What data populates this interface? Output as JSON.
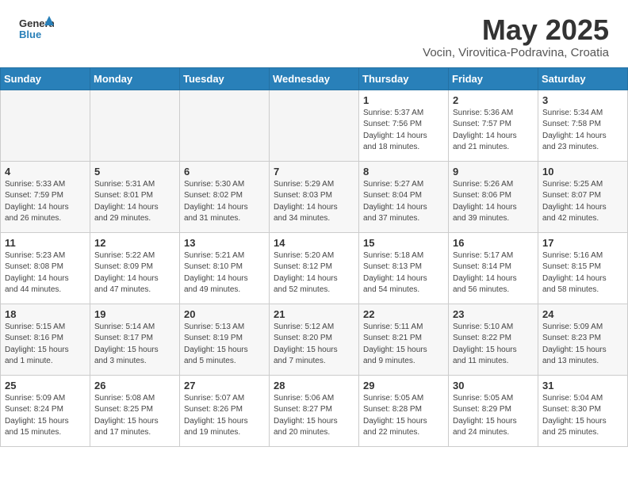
{
  "header": {
    "logo_general": "General",
    "logo_blue": "Blue",
    "month_year": "May 2025",
    "location": "Vocin, Virovitica-Podravina, Croatia"
  },
  "weekdays": [
    "Sunday",
    "Monday",
    "Tuesday",
    "Wednesday",
    "Thursday",
    "Friday",
    "Saturday"
  ],
  "weeks": [
    [
      {
        "day": "",
        "info": ""
      },
      {
        "day": "",
        "info": ""
      },
      {
        "day": "",
        "info": ""
      },
      {
        "day": "",
        "info": ""
      },
      {
        "day": "1",
        "info": "Sunrise: 5:37 AM\nSunset: 7:56 PM\nDaylight: 14 hours\nand 18 minutes."
      },
      {
        "day": "2",
        "info": "Sunrise: 5:36 AM\nSunset: 7:57 PM\nDaylight: 14 hours\nand 21 minutes."
      },
      {
        "day": "3",
        "info": "Sunrise: 5:34 AM\nSunset: 7:58 PM\nDaylight: 14 hours\nand 23 minutes."
      }
    ],
    [
      {
        "day": "4",
        "info": "Sunrise: 5:33 AM\nSunset: 7:59 PM\nDaylight: 14 hours\nand 26 minutes."
      },
      {
        "day": "5",
        "info": "Sunrise: 5:31 AM\nSunset: 8:01 PM\nDaylight: 14 hours\nand 29 minutes."
      },
      {
        "day": "6",
        "info": "Sunrise: 5:30 AM\nSunset: 8:02 PM\nDaylight: 14 hours\nand 31 minutes."
      },
      {
        "day": "7",
        "info": "Sunrise: 5:29 AM\nSunset: 8:03 PM\nDaylight: 14 hours\nand 34 minutes."
      },
      {
        "day": "8",
        "info": "Sunrise: 5:27 AM\nSunset: 8:04 PM\nDaylight: 14 hours\nand 37 minutes."
      },
      {
        "day": "9",
        "info": "Sunrise: 5:26 AM\nSunset: 8:06 PM\nDaylight: 14 hours\nand 39 minutes."
      },
      {
        "day": "10",
        "info": "Sunrise: 5:25 AM\nSunset: 8:07 PM\nDaylight: 14 hours\nand 42 minutes."
      }
    ],
    [
      {
        "day": "11",
        "info": "Sunrise: 5:23 AM\nSunset: 8:08 PM\nDaylight: 14 hours\nand 44 minutes."
      },
      {
        "day": "12",
        "info": "Sunrise: 5:22 AM\nSunset: 8:09 PM\nDaylight: 14 hours\nand 47 minutes."
      },
      {
        "day": "13",
        "info": "Sunrise: 5:21 AM\nSunset: 8:10 PM\nDaylight: 14 hours\nand 49 minutes."
      },
      {
        "day": "14",
        "info": "Sunrise: 5:20 AM\nSunset: 8:12 PM\nDaylight: 14 hours\nand 52 minutes."
      },
      {
        "day": "15",
        "info": "Sunrise: 5:18 AM\nSunset: 8:13 PM\nDaylight: 14 hours\nand 54 minutes."
      },
      {
        "day": "16",
        "info": "Sunrise: 5:17 AM\nSunset: 8:14 PM\nDaylight: 14 hours\nand 56 minutes."
      },
      {
        "day": "17",
        "info": "Sunrise: 5:16 AM\nSunset: 8:15 PM\nDaylight: 14 hours\nand 58 minutes."
      }
    ],
    [
      {
        "day": "18",
        "info": "Sunrise: 5:15 AM\nSunset: 8:16 PM\nDaylight: 15 hours\nand 1 minute."
      },
      {
        "day": "19",
        "info": "Sunrise: 5:14 AM\nSunset: 8:17 PM\nDaylight: 15 hours\nand 3 minutes."
      },
      {
        "day": "20",
        "info": "Sunrise: 5:13 AM\nSunset: 8:19 PM\nDaylight: 15 hours\nand 5 minutes."
      },
      {
        "day": "21",
        "info": "Sunrise: 5:12 AM\nSunset: 8:20 PM\nDaylight: 15 hours\nand 7 minutes."
      },
      {
        "day": "22",
        "info": "Sunrise: 5:11 AM\nSunset: 8:21 PM\nDaylight: 15 hours\nand 9 minutes."
      },
      {
        "day": "23",
        "info": "Sunrise: 5:10 AM\nSunset: 8:22 PM\nDaylight: 15 hours\nand 11 minutes."
      },
      {
        "day": "24",
        "info": "Sunrise: 5:09 AM\nSunset: 8:23 PM\nDaylight: 15 hours\nand 13 minutes."
      }
    ],
    [
      {
        "day": "25",
        "info": "Sunrise: 5:09 AM\nSunset: 8:24 PM\nDaylight: 15 hours\nand 15 minutes."
      },
      {
        "day": "26",
        "info": "Sunrise: 5:08 AM\nSunset: 8:25 PM\nDaylight: 15 hours\nand 17 minutes."
      },
      {
        "day": "27",
        "info": "Sunrise: 5:07 AM\nSunset: 8:26 PM\nDaylight: 15 hours\nand 19 minutes."
      },
      {
        "day": "28",
        "info": "Sunrise: 5:06 AM\nSunset: 8:27 PM\nDaylight: 15 hours\nand 20 minutes."
      },
      {
        "day": "29",
        "info": "Sunrise: 5:05 AM\nSunset: 8:28 PM\nDaylight: 15 hours\nand 22 minutes."
      },
      {
        "day": "30",
        "info": "Sunrise: 5:05 AM\nSunset: 8:29 PM\nDaylight: 15 hours\nand 24 minutes."
      },
      {
        "day": "31",
        "info": "Sunrise: 5:04 AM\nSunset: 8:30 PM\nDaylight: 15 hours\nand 25 minutes."
      }
    ]
  ]
}
